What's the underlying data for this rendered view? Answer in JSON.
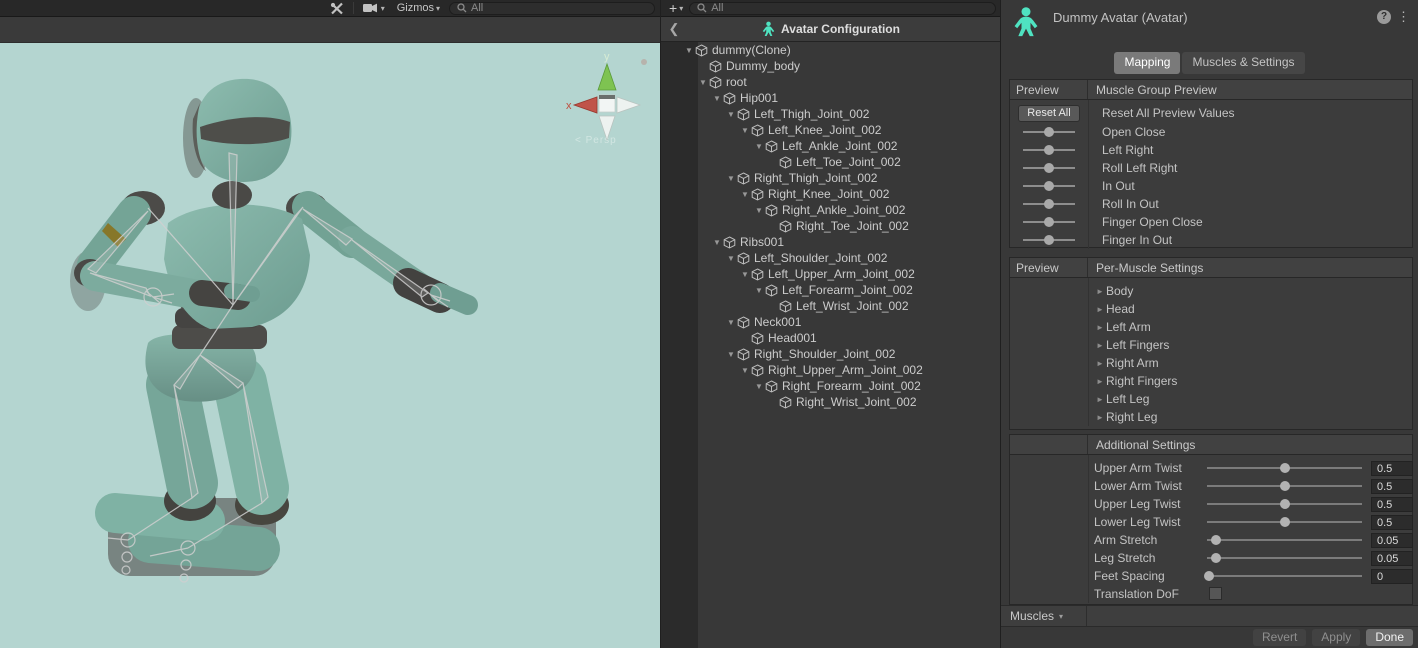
{
  "scene": {
    "toolbar": {
      "gizmos_label": "Gizmos",
      "search_placeholder": "All"
    },
    "gizmo": {
      "x_label": "x",
      "y_label": "y",
      "persp_label": "< Persp"
    }
  },
  "hierarchy": {
    "add_button": "+",
    "search_placeholder": "All",
    "header_title": "Avatar Configuration",
    "tree": [
      {
        "label": "dummy(Clone)",
        "depth": 0,
        "arrow": true
      },
      {
        "label": "Dummy_body",
        "depth": 1,
        "arrow": false
      },
      {
        "label": "root",
        "depth": 1,
        "arrow": true
      },
      {
        "label": "Hip001",
        "depth": 2,
        "arrow": true
      },
      {
        "label": "Left_Thigh_Joint_002",
        "depth": 3,
        "arrow": true
      },
      {
        "label": "Left_Knee_Joint_002",
        "depth": 4,
        "arrow": true
      },
      {
        "label": "Left_Ankle_Joint_002",
        "depth": 5,
        "arrow": true
      },
      {
        "label": "Left_Toe_Joint_002",
        "depth": 6,
        "arrow": false
      },
      {
        "label": "Right_Thigh_Joint_002",
        "depth": 3,
        "arrow": true
      },
      {
        "label": "Right_Knee_Joint_002",
        "depth": 4,
        "arrow": true
      },
      {
        "label": "Right_Ankle_Joint_002",
        "depth": 5,
        "arrow": true
      },
      {
        "label": "Right_Toe_Joint_002",
        "depth": 6,
        "arrow": false
      },
      {
        "label": "Ribs001",
        "depth": 2,
        "arrow": true
      },
      {
        "label": "Left_Shoulder_Joint_002",
        "depth": 3,
        "arrow": true
      },
      {
        "label": "Left_Upper_Arm_Joint_002",
        "depth": 4,
        "arrow": true
      },
      {
        "label": "Left_Forearm_Joint_002",
        "depth": 5,
        "arrow": true
      },
      {
        "label": "Left_Wrist_Joint_002",
        "depth": 6,
        "arrow": false
      },
      {
        "label": "Neck001",
        "depth": 3,
        "arrow": true
      },
      {
        "label": "Head001",
        "depth": 4,
        "arrow": false
      },
      {
        "label": "Right_Shoulder_Joint_002",
        "depth": 3,
        "arrow": true
      },
      {
        "label": "Right_Upper_Arm_Joint_002",
        "depth": 4,
        "arrow": true
      },
      {
        "label": "Right_Forearm_Joint_002",
        "depth": 5,
        "arrow": true
      },
      {
        "label": "Right_Wrist_Joint_002",
        "depth": 6,
        "arrow": false
      }
    ]
  },
  "inspector": {
    "title": "Dummy Avatar (Avatar)",
    "help_label": "?",
    "kebab_label": "⋮",
    "tabs": [
      {
        "label": "Mapping",
        "active": true
      },
      {
        "label": "Muscles & Settings",
        "active": false
      }
    ],
    "muscle_group_preview": {
      "left_header": "Preview",
      "right_header": "Muscle Group Preview",
      "reset_button_label": "Reset All",
      "reset_row_label": "Reset All Preview Values",
      "sliders": [
        {
          "label": "Open Close",
          "pct": 50
        },
        {
          "label": "Left Right",
          "pct": 50
        },
        {
          "label": "Roll Left Right",
          "pct": 50
        },
        {
          "label": "In Out",
          "pct": 50
        },
        {
          "label": "Roll In Out",
          "pct": 50
        },
        {
          "label": "Finger Open Close",
          "pct": 50
        },
        {
          "label": "Finger In Out",
          "pct": 50
        }
      ]
    },
    "per_muscle": {
      "left_header": "Preview",
      "right_header": "Per-Muscle Settings",
      "groups": [
        "Body",
        "Head",
        "Left Arm",
        "Left Fingers",
        "Right Arm",
        "Right Fingers",
        "Left Leg",
        "Right Leg"
      ]
    },
    "additional": {
      "header": "Additional Settings",
      "rows": [
        {
          "label": "Upper Arm Twist",
          "value": "0.5",
          "pct": 50
        },
        {
          "label": "Lower Arm Twist",
          "value": "0.5",
          "pct": 50
        },
        {
          "label": "Upper Leg Twist",
          "value": "0.5",
          "pct": 50
        },
        {
          "label": "Lower Leg Twist",
          "value": "0.5",
          "pct": 50
        },
        {
          "label": "Arm Stretch",
          "value": "0.05",
          "pct": 6
        },
        {
          "label": "Leg Stretch",
          "value": "0.05",
          "pct": 6
        },
        {
          "label": "Feet Spacing",
          "value": "0",
          "pct": 1
        }
      ],
      "checkbox_label": "Translation DoF",
      "checkbox_checked": false
    },
    "muscles_dropdown_label": "Muscles",
    "footer_buttons": [
      {
        "label": "Revert",
        "enabled": false
      },
      {
        "label": "Apply",
        "enabled": false
      },
      {
        "label": "Done",
        "enabled": true
      }
    ]
  },
  "colors": {
    "accent_teal": "#4fe3c1",
    "viewport_bg": "#b4d5d0",
    "panel_bg": "#383838",
    "toolbar_bg": "#282828",
    "model_teal": "#79a89c"
  }
}
